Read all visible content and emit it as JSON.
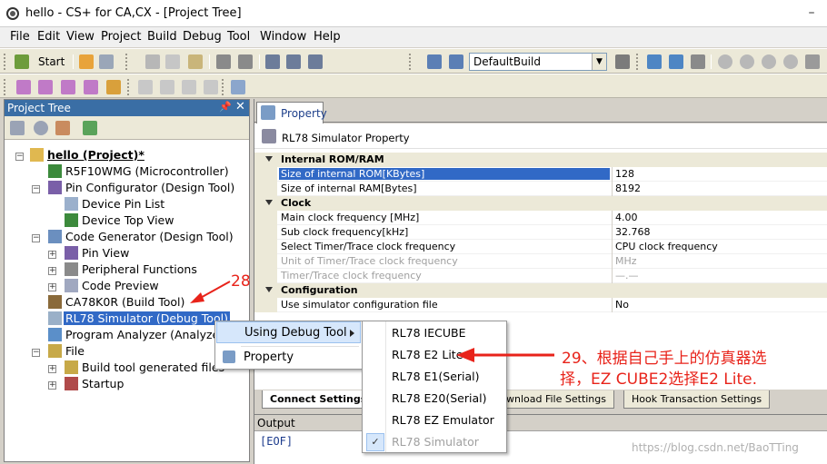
{
  "window": {
    "title": "hello - CS+ for CA,CX - [Project Tree]",
    "minimize_glyph": "–"
  },
  "menu": [
    "File",
    "Edit",
    "View",
    "Project",
    "Build",
    "Debug",
    "Tool",
    "Window",
    "Help"
  ],
  "toolbar": {
    "start_label": "Start",
    "build_config": "DefaultBuild"
  },
  "project_tree": {
    "header": "Project Tree",
    "pin_glyph": "📌",
    "close_glyph": "✕",
    "nodes": [
      {
        "label": "hello (Project)*"
      },
      {
        "label": "R5F10WMG (Microcontroller)"
      },
      {
        "label": "Pin Configurator (Design Tool)"
      },
      {
        "label": "Device Pin List"
      },
      {
        "label": "Device Top View"
      },
      {
        "label": "Code Generator (Design Tool)"
      },
      {
        "label": "Pin View"
      },
      {
        "label": "Peripheral Functions"
      },
      {
        "label": "Code Preview"
      },
      {
        "label": "CA78K0R (Build Tool)"
      },
      {
        "label": "RL78 Simulator (Debug Tool)"
      },
      {
        "label": "Program Analyzer (Analyze T"
      },
      {
        "label": "File"
      },
      {
        "label": "Build tool generated files"
      },
      {
        "label": "Startup"
      }
    ]
  },
  "property": {
    "tab_label": "Property",
    "panel_title": "RL78 Simulator Property",
    "rows": [
      {
        "key": "Internal ROM/RAM",
        "value": ""
      },
      {
        "key": "Size of internal ROM[KBytes]",
        "value": "128"
      },
      {
        "key": "Size of internal RAM[Bytes]",
        "value": "8192"
      },
      {
        "key": "Clock",
        "value": ""
      },
      {
        "key": "Main clock frequency [MHz]",
        "value": "4.00"
      },
      {
        "key": "Sub clock frequency[kHz]",
        "value": "32.768"
      },
      {
        "key": "Select Timer/Trace clock frequency",
        "value": "CPU clock frequency"
      },
      {
        "key": "Unit of Timer/Trace clock frequency",
        "value": "MHz"
      },
      {
        "key": "Timer/Trace clock frequency",
        "value": "—.—"
      },
      {
        "key": "Configuration",
        "value": ""
      },
      {
        "key": "Use simulator configuration file",
        "value": "No"
      }
    ],
    "bottom_tabs": [
      "Connect Settings",
      "wnload File Settings",
      "Hook Transaction Settings"
    ]
  },
  "output": {
    "header": "Output",
    "text": "[EOF]"
  },
  "context_menu": {
    "items": [
      "Using Debug Tool",
      "Property"
    ]
  },
  "submenu": {
    "items": [
      "RL78 IECUBE",
      "RL78 E2 Lite",
      "RL78 E1(Serial)",
      "RL78 E20(Serial)",
      "RL78 EZ Emulator",
      "RL78 Simulator"
    ],
    "check_glyph": "✓"
  },
  "annotations": {
    "step28": "28",
    "step29_line1": "29、根据自己手上的仿真器选",
    "step29_line2": "择，EZ CUBE2选择E2 Lite."
  },
  "watermark": "https://blog.csdn.net/BaoTTing",
  "colors": {
    "accent": "#3169c6",
    "annotation": "#e8231a",
    "header": "#3a6ea5"
  }
}
